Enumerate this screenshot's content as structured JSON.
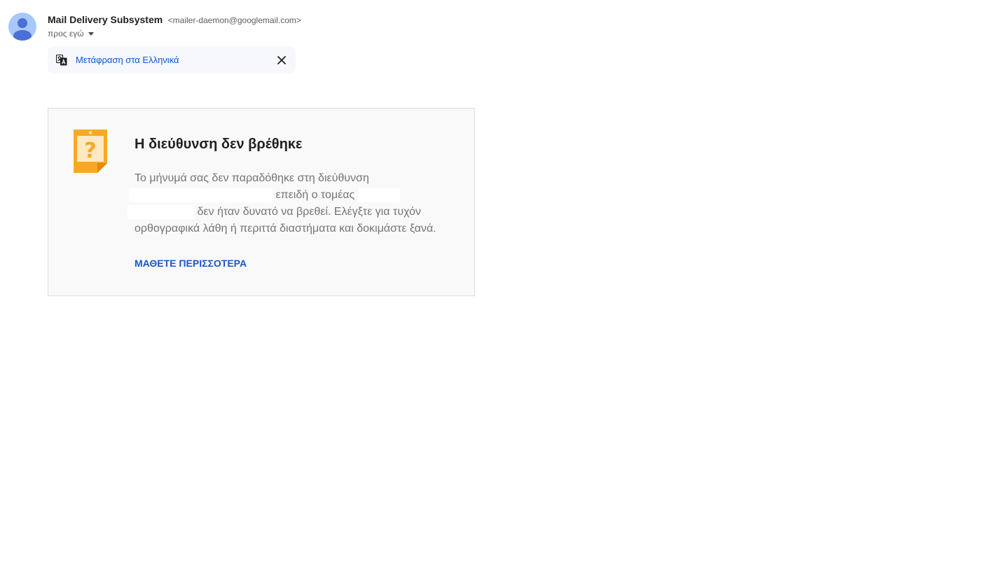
{
  "sender": {
    "name": "Mail Delivery Subsystem",
    "email": "<mailer-daemon@googlemail.com>",
    "recipient_label": "προς εγώ",
    "avatar_icon": "person-avatar-icon"
  },
  "translate_banner": {
    "icon": "translate-icon",
    "link_label": "Μετάφραση στα Ελληνικά",
    "close_icon": "close-icon"
  },
  "bounce_card": {
    "icon": "question-note-icon",
    "title": "Η διεύθυνση δεν βρέθηκε",
    "body_part1": "Το μήνυμά σας δεν παραδόθηκε στη διεύθυνση",
    "body_part2": "επειδή ο τομέας",
    "body_part3": "δεν ήταν δυνατό να βρεθεί. Ελέγξτε για τυχόν ορθογραφικά λάθη ή περιττά διαστήματα και δοκιμάστε ξανά.",
    "learn_more_label": "ΜΑΘΕΤΕ ΠΕΡΙΣΣΟΤΕΡΑ"
  },
  "colors": {
    "accent": "#0b57d0",
    "link": "#1a57c5",
    "icon_orange": "#f9a825",
    "card_bg": "#f9f9f9"
  }
}
